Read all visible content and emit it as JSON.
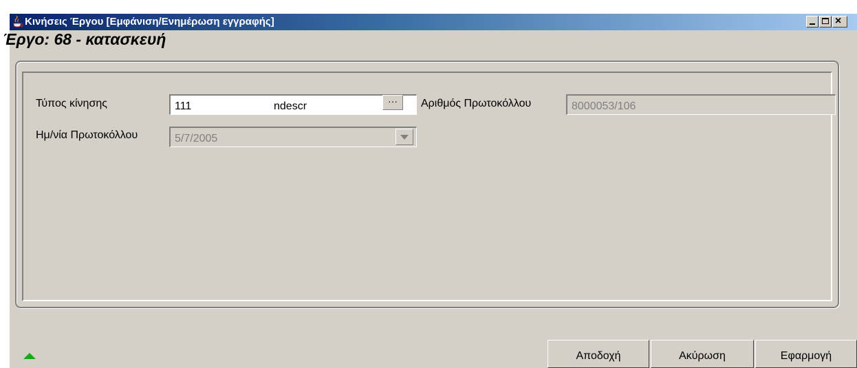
{
  "window": {
    "title": "Κινήσεις Έργου [Εμφάνιση/Ενημέρωση εγγραφής]",
    "controls": {
      "minimize": "_",
      "maximize": "□",
      "close": "×"
    }
  },
  "heading": "Έργο: 68 - κατασκευή",
  "form": {
    "movement_type": {
      "label": "Τύπος κίνησης",
      "value": "111",
      "description": "ndescr",
      "lookup_label": "···"
    },
    "protocol_number": {
      "label": "Αριθμός Πρωτοκόλλου",
      "value": "8000053/106"
    },
    "protocol_date": {
      "label": "Ημ/νία Πρωτοκόλλου",
      "value": "5/7/2005"
    }
  },
  "buttons": {
    "accept": "Αποδοχή",
    "cancel": "Ακύρωση",
    "apply": "Εφαρμογή"
  },
  "icons": {
    "app": "java-cup-icon",
    "status": "green-up-arrow-icon"
  },
  "colors": {
    "titlebar_start": "#0a246a",
    "titlebar_end": "#a6caf0",
    "window_bg": "#d4d0c8"
  }
}
